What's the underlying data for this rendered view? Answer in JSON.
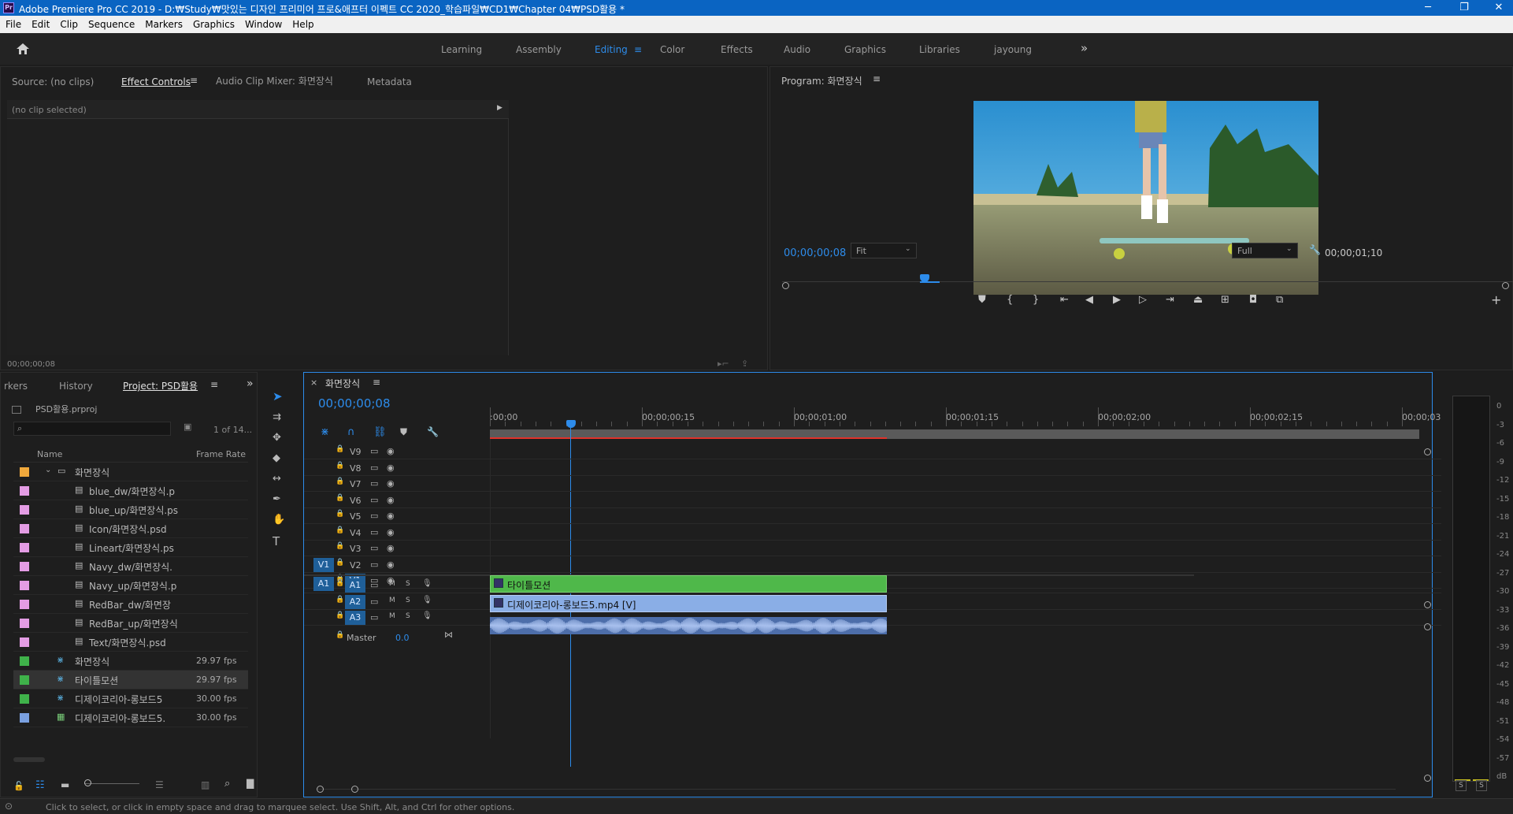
{
  "titlebar": {
    "title": "Adobe Premiere Pro CC 2019 - D:₩Study₩맛있는 디자인 프리미어 프로&애프터 이펙트 CC 2020_학습파일₩CD1₩Chapter 04₩PSD활용 *",
    "icon": "Pr",
    "minimize": "─",
    "maximize": "❐",
    "close": "✕"
  },
  "menu": [
    "File",
    "Edit",
    "Clip",
    "Sequence",
    "Markers",
    "Graphics",
    "Window",
    "Help"
  ],
  "workspaces": [
    "Learning",
    "Assembly",
    "Editing",
    "Color",
    "Effects",
    "Audio",
    "Graphics",
    "Libraries",
    "jayoung"
  ],
  "workspace_more": "»",
  "source_tabs": [
    "Source: (no clips)",
    "Effect Controls",
    "Audio Clip Mixer: 화면장식",
    "Metadata"
  ],
  "effect_controls": {
    "no_clip": "(no clip selected)",
    "timecode": "00;00;00;08"
  },
  "program": {
    "title": "Program: 화면장식",
    "timecode": "00;00;00;08",
    "fit": "Fit",
    "full": "Full",
    "duration": "00;00;01;10"
  },
  "project": {
    "tabs": [
      "rkers",
      "History",
      "Project: PSD활용"
    ],
    "file": "PSD활용.prproj",
    "count": "1 of 14...",
    "col_name": "Name",
    "col_fps": "Frame Rate",
    "items": [
      {
        "name": "화면장식",
        "fps": "",
        "color": "#f0a93c",
        "type": "folder"
      },
      {
        "name": "blue_dw/화면장식.p",
        "fps": "",
        "color": "#e39ce4",
        "type": "psd"
      },
      {
        "name": "blue_up/화면장식.ps",
        "fps": "",
        "color": "#e39ce4",
        "type": "psd"
      },
      {
        "name": "Icon/화면장식.psd",
        "fps": "",
        "color": "#e39ce4",
        "type": "psd"
      },
      {
        "name": "Lineart/화면장식.ps",
        "fps": "",
        "color": "#e39ce4",
        "type": "psd"
      },
      {
        "name": "Navy_dw/화면장식.",
        "fps": "",
        "color": "#e39ce4",
        "type": "psd"
      },
      {
        "name": "Navy_up/화면장식.p",
        "fps": "",
        "color": "#e39ce4",
        "type": "psd"
      },
      {
        "name": "RedBar_dw/화면장",
        "fps": "",
        "color": "#e39ce4",
        "type": "psd"
      },
      {
        "name": "RedBar_up/화면장식",
        "fps": "",
        "color": "#e39ce4",
        "type": "psd"
      },
      {
        "name": "Text/화면장식.psd",
        "fps": "",
        "color": "#e39ce4",
        "type": "psd"
      },
      {
        "name": "화면장식",
        "fps": "29.97 fps",
        "color": "#3fb24a",
        "type": "seq"
      },
      {
        "name": "타이틀모션",
        "fps": "29.97 fps",
        "color": "#3fb24a",
        "type": "seq"
      },
      {
        "name": "디제이코리아-롱보드5",
        "fps": "30.00 fps",
        "color": "#3fb24a",
        "type": "seq"
      },
      {
        "name": "디제이코리아-롱보드5.",
        "fps": "30.00 fps",
        "color": "#7aa0e0",
        "type": "clip"
      }
    ]
  },
  "timeline": {
    "tab": "화면장식",
    "timecode": "00;00;00;08",
    "ruler": [
      ":00;00",
      "00;00;00;15",
      "00;00;01;00",
      "00;00;01;15",
      "00;00;02;00",
      "00;00;02;15",
      "00;00;03;00"
    ],
    "video_tracks": [
      "V9",
      "V8",
      "V7",
      "V6",
      "V5",
      "V4",
      "V3",
      "V2",
      "V1"
    ],
    "audio_tracks": [
      "A1",
      "A2",
      "A3"
    ],
    "src_v": "V1",
    "src_a": "A1",
    "master": "Master",
    "master_val": "0.0",
    "clip_title": "타이틀모션",
    "clip_video": "디제이코리아-롱보드5.mp4 [V]",
    "m": "M",
    "s": "S"
  },
  "meter": {
    "labels": [
      "0",
      "-3",
      "-6",
      "-9",
      "-12",
      "-15",
      "-18",
      "-21",
      "-24",
      "-27",
      "-30",
      "-33",
      "-36",
      "-39",
      "-42",
      "-45",
      "-48",
      "-51",
      "-54",
      "-57",
      "dB"
    ],
    "solo": "S"
  },
  "status": "Click to select, or click in empty space and drag to marquee select. Use Shift, Alt, and Ctrl for other options."
}
